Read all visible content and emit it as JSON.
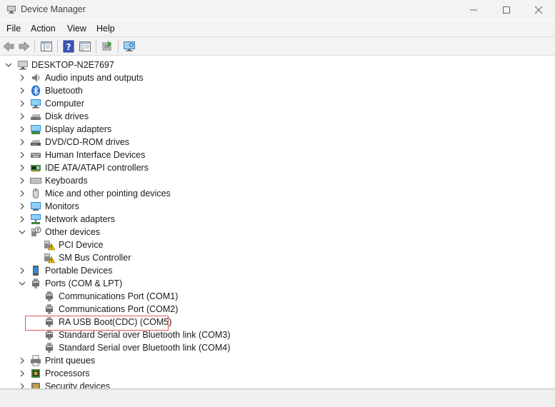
{
  "window": {
    "title": "Device Manager"
  },
  "menu": [
    "File",
    "Action",
    "View",
    "Help"
  ],
  "toolbar": {
    "buttons": [
      "back-icon",
      "forward-icon",
      "properties-pane-icon",
      "help-icon",
      "details-icon",
      "update-driver-icon",
      "scan-hardware-icon"
    ]
  },
  "tree": {
    "root": "DESKTOP-N2E7697",
    "categories": [
      {
        "label": "Audio inputs and outputs",
        "icon": "speaker-icon",
        "expanded": false
      },
      {
        "label": "Bluetooth",
        "icon": "bluetooth-icon",
        "expanded": false
      },
      {
        "label": "Computer",
        "icon": "computer-icon",
        "expanded": false
      },
      {
        "label": "Disk drives",
        "icon": "disk-drive-icon",
        "expanded": false
      },
      {
        "label": "Display adapters",
        "icon": "display-adapter-icon",
        "expanded": false
      },
      {
        "label": "DVD/CD-ROM drives",
        "icon": "dvd-drive-icon",
        "expanded": false
      },
      {
        "label": "Human Interface Devices",
        "icon": "hid-icon",
        "expanded": false
      },
      {
        "label": "IDE ATA/ATAPI controllers",
        "icon": "ide-controller-icon",
        "expanded": false
      },
      {
        "label": "Keyboards",
        "icon": "keyboard-icon",
        "expanded": false
      },
      {
        "label": "Mice and other pointing devices",
        "icon": "mouse-icon",
        "expanded": false
      },
      {
        "label": "Monitors",
        "icon": "monitor-icon",
        "expanded": false
      },
      {
        "label": "Network adapters",
        "icon": "network-adapter-icon",
        "expanded": false
      },
      {
        "label": "Other devices",
        "icon": "unknown-device-icon",
        "expanded": true,
        "children": [
          {
            "label": "PCI Device",
            "icon": "warning-device-icon"
          },
          {
            "label": "SM Bus Controller",
            "icon": "warning-device-icon"
          }
        ]
      },
      {
        "label": "Portable Devices",
        "icon": "portable-device-icon",
        "expanded": false
      },
      {
        "label": "Ports (COM & LPT)",
        "icon": "port-icon",
        "expanded": true,
        "children": [
          {
            "label": "Communications Port (COM1)",
            "icon": "port-icon"
          },
          {
            "label": "Communications Port (COM2)",
            "icon": "port-icon"
          },
          {
            "label": "RA USB Boot(CDC) (COM5)",
            "icon": "port-icon",
            "highlighted": true
          },
          {
            "label": "Standard Serial over Bluetooth link (COM3)",
            "icon": "port-icon"
          },
          {
            "label": "Standard Serial over Bluetooth link (COM4)",
            "icon": "port-icon"
          }
        ]
      },
      {
        "label": "Print queues",
        "icon": "printer-icon",
        "expanded": false
      },
      {
        "label": "Processors",
        "icon": "processor-icon",
        "expanded": false
      },
      {
        "label": "Security devices",
        "icon": "security-device-icon",
        "expanded": false
      }
    ]
  },
  "colors": {
    "highlight_border": "#e05a5a",
    "chrome_bg": "#f3f3f3"
  }
}
